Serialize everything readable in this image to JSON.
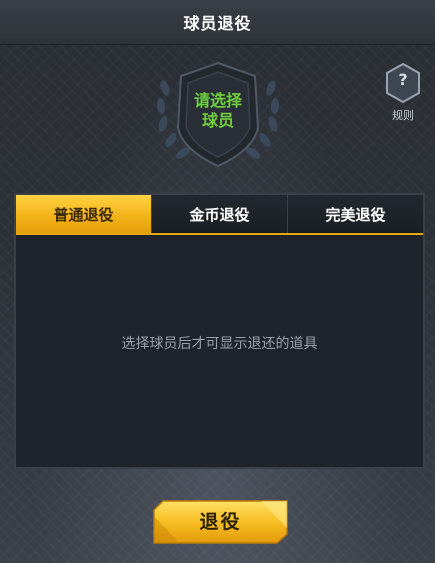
{
  "header": {
    "title": "球员退役"
  },
  "badge": {
    "line1": "请选择",
    "line2": "球员",
    "icon": "shield-laurel-icon",
    "text_color": "#6fcf3c"
  },
  "rules": {
    "icon_glyph": "?",
    "label": "规则"
  },
  "tabs": [
    {
      "label": "普通退役",
      "active": true
    },
    {
      "label": "金币退役",
      "active": false
    },
    {
      "label": "完美退役",
      "active": false
    }
  ],
  "panel": {
    "empty_message": "选择球员后才可显示退还的道具"
  },
  "footer": {
    "retire_label": "退役"
  },
  "colors": {
    "accent": "#f4b41a",
    "background": "#2c3037",
    "panel": "#1f232b"
  }
}
